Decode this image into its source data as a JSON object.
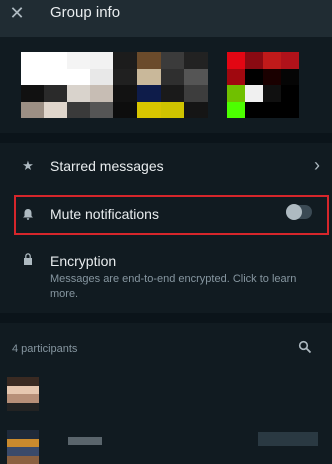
{
  "header": {
    "title": "Group info",
    "close_icon": "close-icon"
  },
  "menu": {
    "starred": {
      "label": "Starred messages",
      "icon": "star-icon",
      "chevron": "chevron-right-icon"
    },
    "mute": {
      "label": "Mute notifications",
      "icon": "bell-icon",
      "toggle_on": false
    },
    "encryption": {
      "label": "Encryption",
      "icon": "lock-icon",
      "description": "Messages are end-to-end encrypted. Click to learn more."
    }
  },
  "participants": {
    "count_label": "4 participants",
    "search_icon": "search-icon"
  },
  "colors": {
    "background": "#111b21",
    "header": "#202c33",
    "highlight": "#d6262b"
  }
}
